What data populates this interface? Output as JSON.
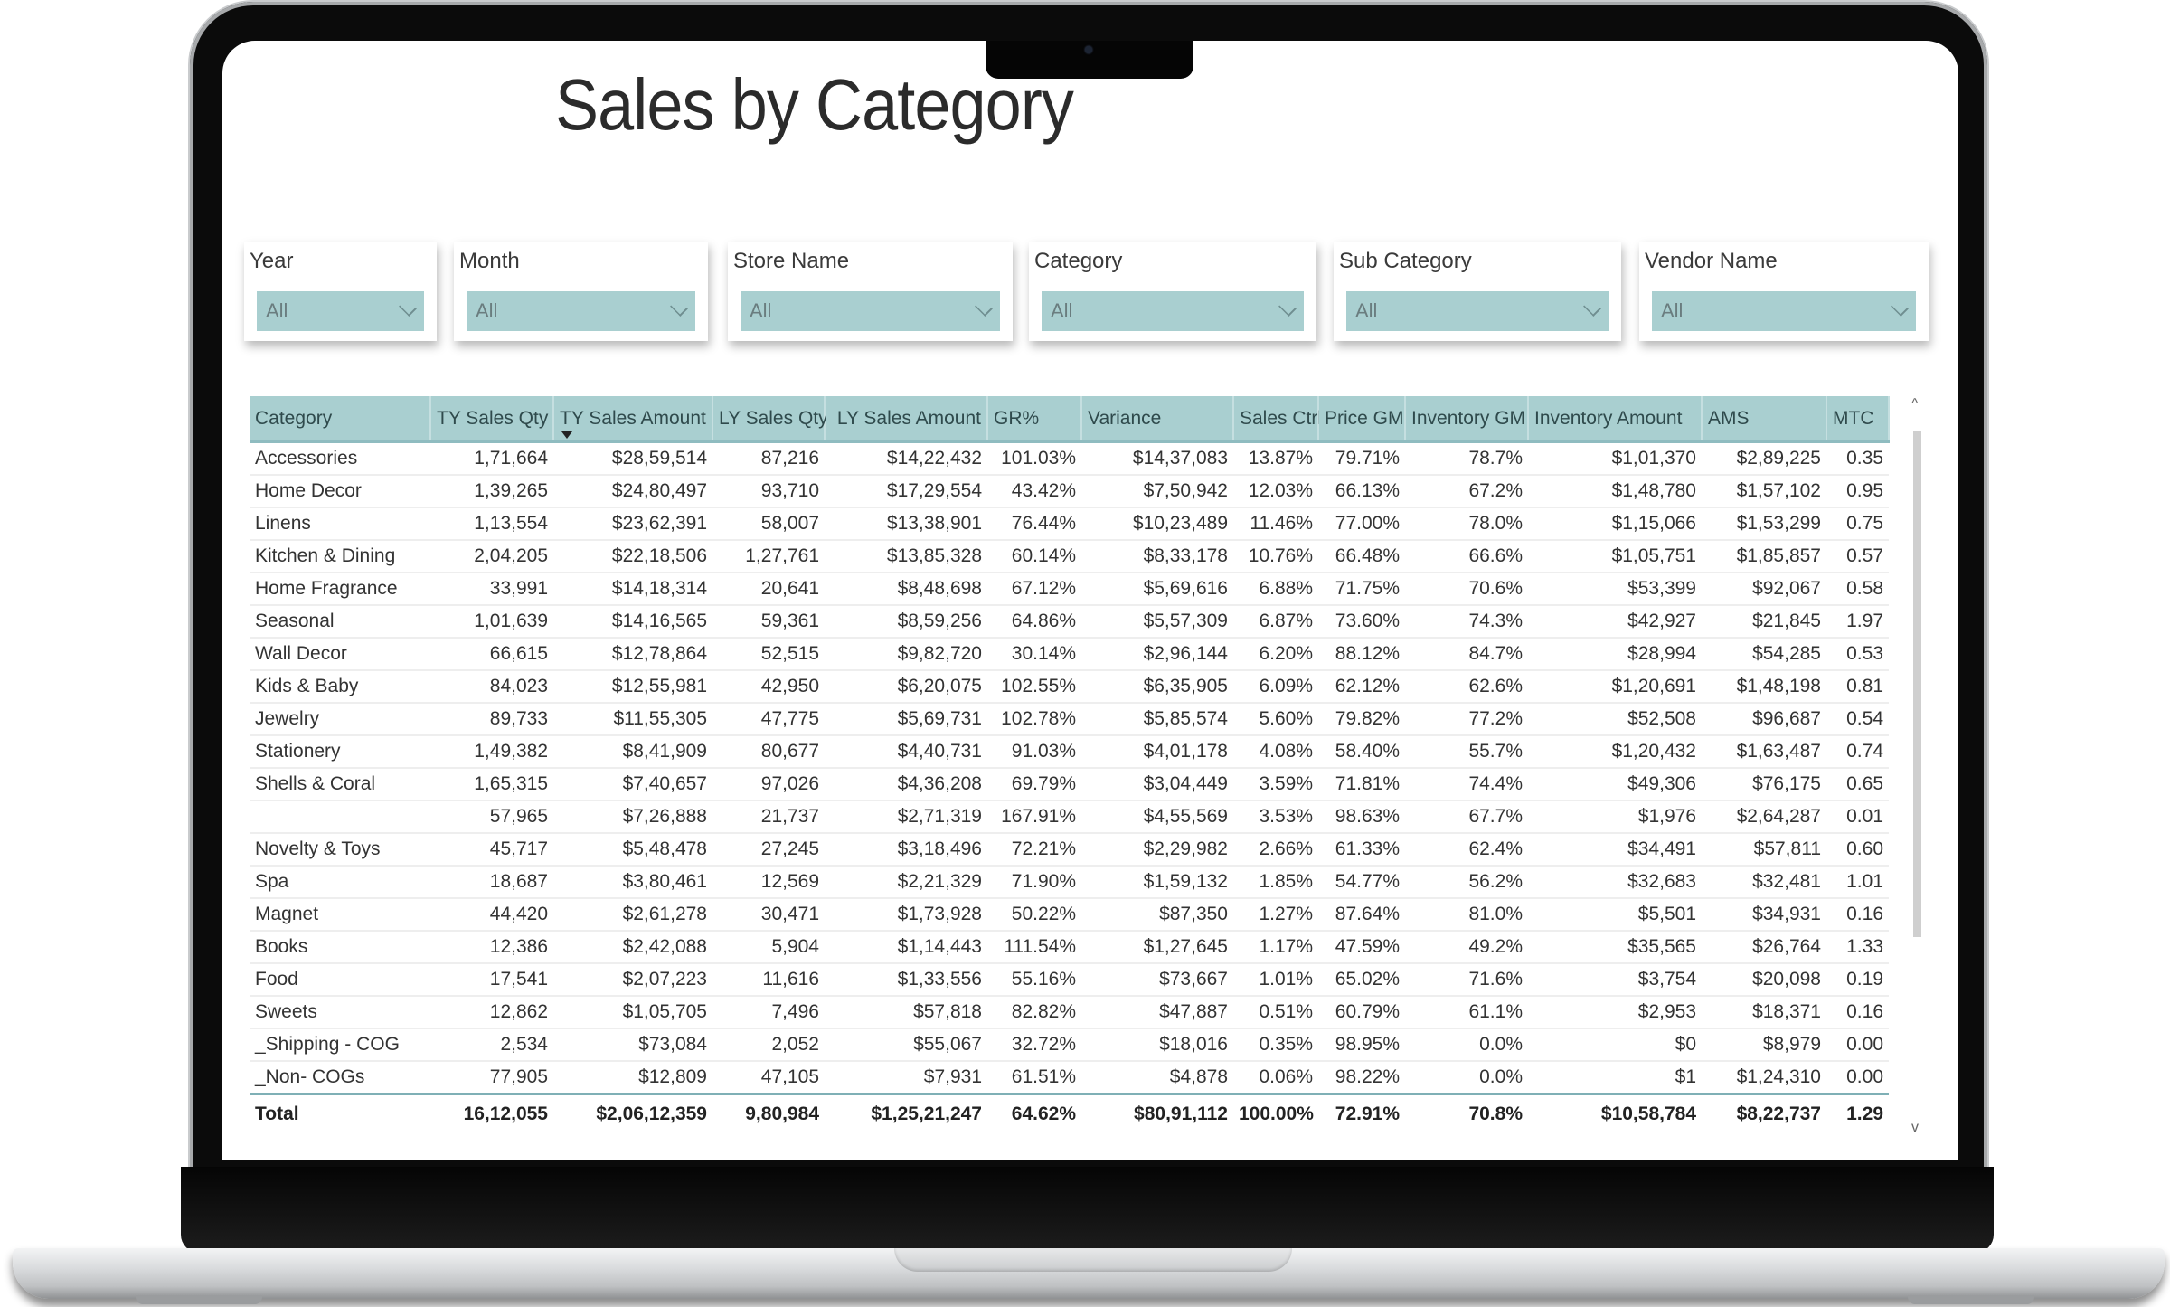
{
  "report": {
    "title": "Sales by Category"
  },
  "slicers": [
    {
      "label": "Year",
      "value": "All"
    },
    {
      "label": "Month",
      "value": "All"
    },
    {
      "label": "Store Name",
      "value": "All"
    },
    {
      "label": "Category",
      "value": "All"
    },
    {
      "label": "Sub Category",
      "value": "All"
    },
    {
      "label": "Vendor Name",
      "value": "All"
    }
  ],
  "table": {
    "sorted_column": "TY Sales Amount",
    "sort_direction": "descending",
    "columns": [
      "Category",
      "TY Sales Qty",
      "TY Sales Amount",
      "LY Sales Qty",
      "LY Sales Amount",
      "GR%",
      "Variance",
      "Sales Ctrl",
      "Price GM",
      "Inventory GM",
      "Inventory Amount",
      "AMS",
      "MTC"
    ],
    "rows": [
      [
        "Accessories",
        "1,71,664",
        "$28,59,514",
        "87,216",
        "$14,22,432",
        "101.03%",
        "$14,37,083",
        "13.87%",
        "79.71%",
        "78.7%",
        "$1,01,370",
        "$2,89,225",
        "0.35"
      ],
      [
        "Home Decor",
        "1,39,265",
        "$24,80,497",
        "93,710",
        "$17,29,554",
        "43.42%",
        "$7,50,942",
        "12.03%",
        "66.13%",
        "67.2%",
        "$1,48,780",
        "$1,57,102",
        "0.95"
      ],
      [
        "Linens",
        "1,13,554",
        "$23,62,391",
        "58,007",
        "$13,38,901",
        "76.44%",
        "$10,23,489",
        "11.46%",
        "77.00%",
        "78.0%",
        "$1,15,066",
        "$1,53,299",
        "0.75"
      ],
      [
        "Kitchen & Dining",
        "2,04,205",
        "$22,18,506",
        "1,27,761",
        "$13,85,328",
        "60.14%",
        "$8,33,178",
        "10.76%",
        "66.48%",
        "66.6%",
        "$1,05,751",
        "$1,85,857",
        "0.57"
      ],
      [
        "Home Fragrance",
        "33,991",
        "$14,18,314",
        "20,641",
        "$8,48,698",
        "67.12%",
        "$5,69,616",
        "6.88%",
        "71.75%",
        "70.6%",
        "$53,399",
        "$92,067",
        "0.58"
      ],
      [
        "Seasonal",
        "1,01,639",
        "$14,16,565",
        "59,361",
        "$8,59,256",
        "64.86%",
        "$5,57,309",
        "6.87%",
        "73.60%",
        "74.3%",
        "$42,927",
        "$21,845",
        "1.97"
      ],
      [
        "Wall Decor",
        "66,615",
        "$12,78,864",
        "52,515",
        "$9,82,720",
        "30.14%",
        "$2,96,144",
        "6.20%",
        "88.12%",
        "84.7%",
        "$28,994",
        "$54,285",
        "0.53"
      ],
      [
        "Kids & Baby",
        "84,023",
        "$12,55,981",
        "42,950",
        "$6,20,075",
        "102.55%",
        "$6,35,905",
        "6.09%",
        "62.12%",
        "62.6%",
        "$1,20,691",
        "$1,48,198",
        "0.81"
      ],
      [
        "Jewelry",
        "89,733",
        "$11,55,305",
        "47,775",
        "$5,69,731",
        "102.78%",
        "$5,85,574",
        "5.60%",
        "79.82%",
        "77.2%",
        "$52,508",
        "$96,687",
        "0.54"
      ],
      [
        "Stationery",
        "1,49,382",
        "$8,41,909",
        "80,677",
        "$4,40,731",
        "91.03%",
        "$4,01,178",
        "4.08%",
        "58.40%",
        "55.7%",
        "$1,20,432",
        "$1,63,487",
        "0.74"
      ],
      [
        "Shells & Coral",
        "1,65,315",
        "$7,40,657",
        "97,026",
        "$4,36,208",
        "69.79%",
        "$3,04,449",
        "3.59%",
        "71.81%",
        "74.4%",
        "$49,306",
        "$76,175",
        "0.65"
      ],
      [
        "",
        "57,965",
        "$7,26,888",
        "21,737",
        "$2,71,319",
        "167.91%",
        "$4,55,569",
        "3.53%",
        "98.63%",
        "67.7%",
        "$1,976",
        "$2,64,287",
        "0.01"
      ],
      [
        "Novelty & Toys",
        "45,717",
        "$5,48,478",
        "27,245",
        "$3,18,496",
        "72.21%",
        "$2,29,982",
        "2.66%",
        "61.33%",
        "62.4%",
        "$34,491",
        "$57,811",
        "0.60"
      ],
      [
        "Spa",
        "18,687",
        "$3,80,461",
        "12,569",
        "$2,21,329",
        "71.90%",
        "$1,59,132",
        "1.85%",
        "54.77%",
        "56.2%",
        "$32,683",
        "$32,481",
        "1.01"
      ],
      [
        "Magnet",
        "44,420",
        "$2,61,278",
        "30,471",
        "$1,73,928",
        "50.22%",
        "$87,350",
        "1.27%",
        "87.64%",
        "81.0%",
        "$5,501",
        "$34,931",
        "0.16"
      ],
      [
        "Books",
        "12,386",
        "$2,42,088",
        "5,904",
        "$1,14,443",
        "111.54%",
        "$1,27,645",
        "1.17%",
        "47.59%",
        "49.2%",
        "$35,565",
        "$26,764",
        "1.33"
      ],
      [
        "Food",
        "17,541",
        "$2,07,223",
        "11,616",
        "$1,33,556",
        "55.16%",
        "$73,667",
        "1.01%",
        "65.02%",
        "71.6%",
        "$3,754",
        "$20,098",
        "0.19"
      ],
      [
        "Sweets",
        "12,862",
        "$1,05,705",
        "7,496",
        "$57,818",
        "82.82%",
        "$47,887",
        "0.51%",
        "60.79%",
        "61.1%",
        "$2,953",
        "$18,371",
        "0.16"
      ],
      [
        "_Shipping - COG",
        "2,534",
        "$73,084",
        "2,052",
        "$55,067",
        "32.72%",
        "$18,016",
        "0.35%",
        "98.95%",
        "0.0%",
        "$0",
        "$8,979",
        "0.00"
      ],
      [
        "_Non- COGs",
        "77,905",
        "$12,809",
        "47,105",
        "$7,931",
        "61.51%",
        "$4,878",
        "0.06%",
        "98.22%",
        "0.0%",
        "$1",
        "$1,24,310",
        "0.00"
      ]
    ],
    "total": [
      "Total",
      "16,12,055",
      "$2,06,12,359",
      "9,80,984",
      "$1,25,21,247",
      "64.62%",
      "$80,91,112",
      "100.00%",
      "72.91%",
      "70.8%",
      "$10,58,784",
      "$8,22,737",
      "1.29"
    ]
  },
  "icons": {
    "dropdown": "chevron-down-icon",
    "sort": "sort-descending-icon",
    "scroll_up": "^",
    "scroll_down": "v"
  },
  "colors": {
    "header_bg": "#a9cfd0",
    "slicer_bg": "#a9cfd0",
    "total_rule": "#7fb0b6"
  }
}
